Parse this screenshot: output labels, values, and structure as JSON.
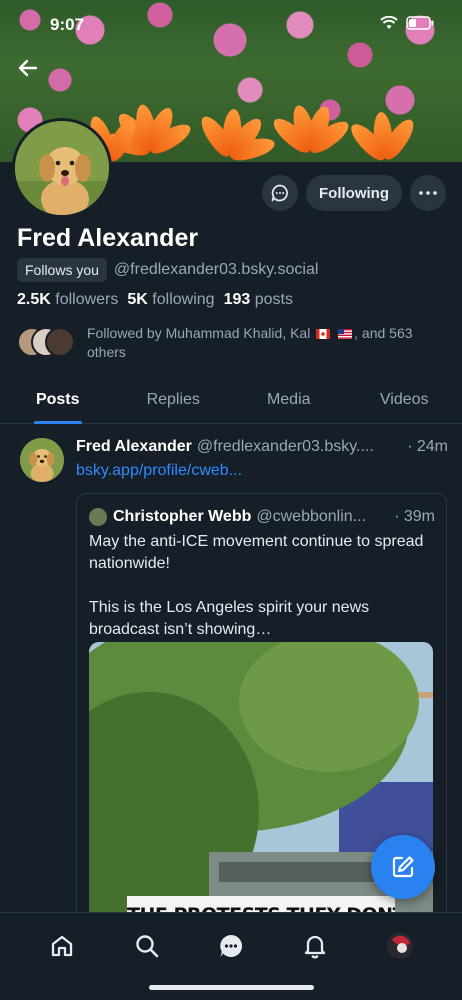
{
  "status_bar": {
    "time": "9:07"
  },
  "profile": {
    "name": "Fred Alexander",
    "follows_you": "Follows you",
    "handle": "@fredlexander03.bsky.social",
    "followers_count": "2.5K",
    "followers_label": "followers",
    "following_count": "5K",
    "following_label": "following",
    "posts_count": "193",
    "posts_label": "posts",
    "followed_by_prefix": "Followed by Muhammad Khalid, Kal",
    "followed_by_suffix": ", and 563 others",
    "follow_button": "Following"
  },
  "tabs": [
    {
      "label": "Posts",
      "active": true
    },
    {
      "label": "Replies",
      "active": false
    },
    {
      "label": "Media",
      "active": false
    },
    {
      "label": "Videos",
      "active": false
    }
  ],
  "post": {
    "author": "Fred Alexander",
    "handle": "@fredlexander03.bsky....",
    "time": "· 24m",
    "link": "bsky.app/profile/cweb...",
    "quote": {
      "author": "Christopher Webb",
      "handle": "@cwebbonlin...",
      "time": "· 39m",
      "line1": "May the anti-ICE movement continue to spread nationwide!",
      "line2": "This is the Los Angeles spirit your news broadcast isn’t showing…",
      "media_caption": "THE PROTESTS THEY DONT"
    }
  },
  "icons": {
    "back": "arrow-left-icon",
    "message": "chat-bubble-icon",
    "more": "ellipsis-icon",
    "compose": "pencil-icon",
    "nav": [
      "home-icon",
      "search-icon",
      "chat-icon",
      "bell-icon",
      "profile-avatar"
    ]
  },
  "colors": {
    "accent": "#2a82f0",
    "link": "#2f8aff",
    "background": "#161e27"
  }
}
